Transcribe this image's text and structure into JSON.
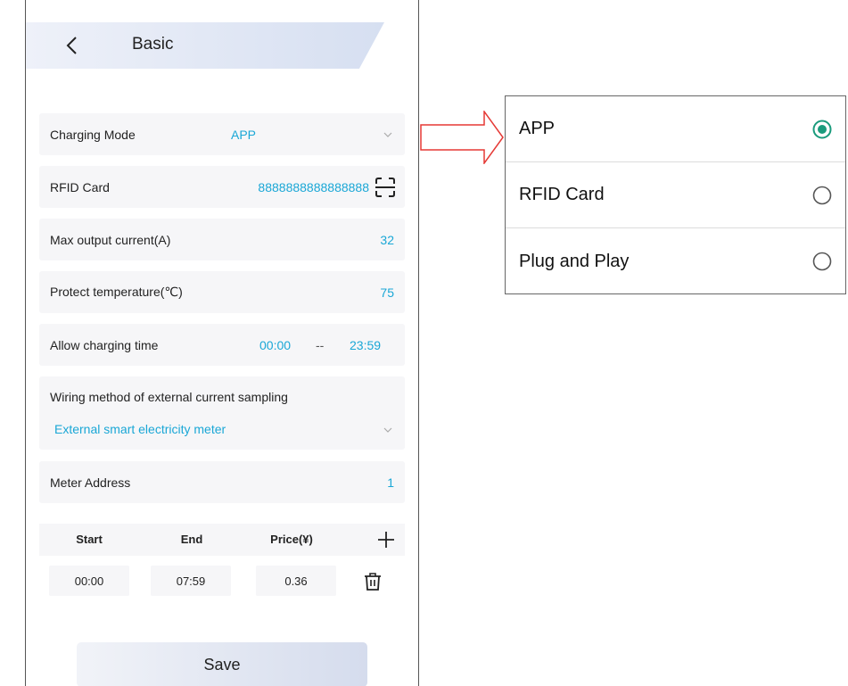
{
  "header": {
    "title": "Basic"
  },
  "fields": {
    "charging_mode": {
      "label": "Charging Mode",
      "value": "APP"
    },
    "rfid_card": {
      "label": "RFID Card",
      "value": "8888888888888888"
    },
    "max_current": {
      "label": "Max output current(A)",
      "value": "32"
    },
    "protect_temp": {
      "label": "Protect temperature(℃)",
      "value": "75"
    },
    "charging_time": {
      "label": "Allow charging time",
      "start": "00:00",
      "separator": "--",
      "end": "23:59"
    },
    "wiring": {
      "label": "Wiring method of external current sampling",
      "value": "External smart electricity meter"
    },
    "meter_address": {
      "label": "Meter Address",
      "value": "1"
    }
  },
  "price_table": {
    "headers": {
      "start": "Start",
      "end": "End",
      "price": "Price(¥)"
    },
    "rows": [
      {
        "start": "00:00",
        "end": "07:59",
        "price": "0.36"
      }
    ]
  },
  "save_label": "Save",
  "dropdown": {
    "options": [
      {
        "label": "APP",
        "selected": true
      },
      {
        "label": "RFID Card",
        "selected": false
      },
      {
        "label": "Plug and Play",
        "selected": false
      }
    ]
  },
  "colors": {
    "accent": "#1aa7d6",
    "radio_selected": "#1a9b7c",
    "arrow": "#e53935"
  }
}
